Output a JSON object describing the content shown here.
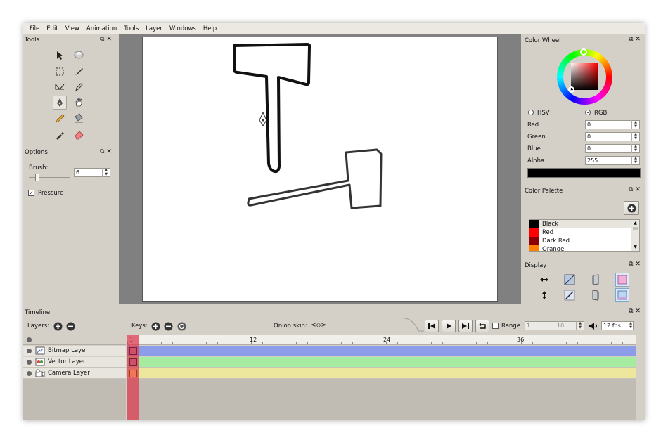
{
  "menu": [
    "File",
    "Edit",
    "View",
    "Animation",
    "Tools",
    "Layer",
    "Windows",
    "Help"
  ],
  "tools_panel": {
    "title": "Tools"
  },
  "options_panel": {
    "title": "Options",
    "brush_label": "Brush:",
    "brush_value": "6",
    "pressure_label": "Pressure"
  },
  "color_wheel": {
    "title": "Color Wheel",
    "hsv_label": "HSV",
    "rgb_label": "RGB",
    "red_label": "Red",
    "red_value": "0",
    "green_label": "Green",
    "green_value": "0",
    "blue_label": "Blue",
    "blue_value": "0",
    "alpha_label": "Alpha",
    "alpha_value": "255",
    "current_color": "#000000"
  },
  "color_palette": {
    "title": "Color Palette",
    "items": [
      {
        "name": "Black",
        "color": "#000000"
      },
      {
        "name": "Red",
        "color": "#ff0000"
      },
      {
        "name": "Dark Red",
        "color": "#8b0000"
      },
      {
        "name": "Orange",
        "color": "#ff8000"
      }
    ]
  },
  "display_panel": {
    "title": "Display"
  },
  "timeline": {
    "title": "Timeline",
    "layers_label": "Layers:",
    "keys_label": "Keys:",
    "onion_label": "Onion skin:",
    "range_label": "Range",
    "range_start": "1",
    "range_end": "10",
    "fps": "12 fps",
    "ruler": [
      "1",
      "12",
      "24",
      "36"
    ],
    "layers": [
      {
        "name": "Bitmap Layer",
        "color": "#8c9ce8"
      },
      {
        "name": "Vector Layer",
        "color": "#a6eca0"
      },
      {
        "name": "Camera Layer",
        "color": "#ece79c"
      }
    ]
  }
}
